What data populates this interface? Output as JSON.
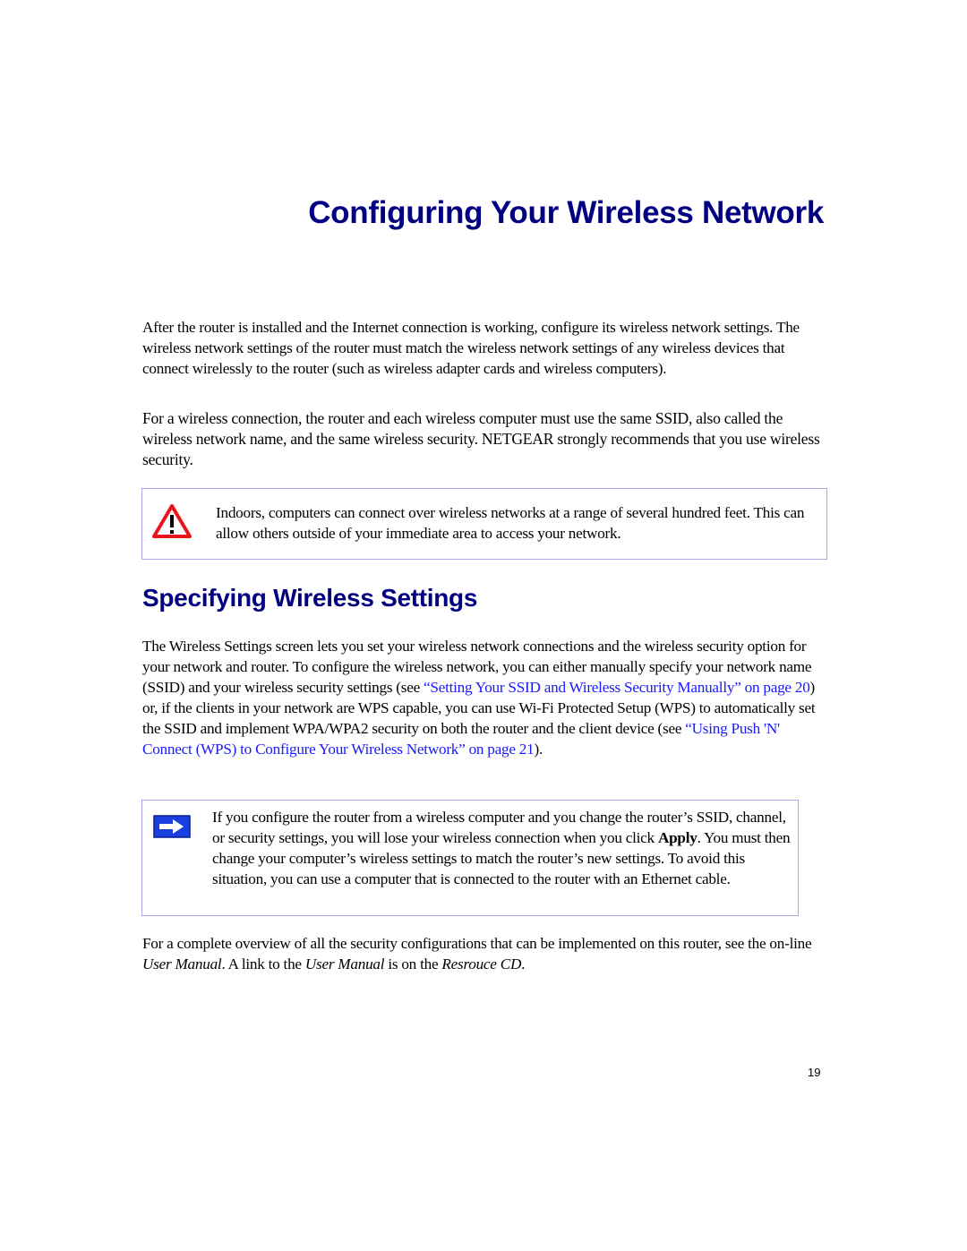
{
  "page": {
    "title": "Configuring Your Wireless Network",
    "intro_paragraphs": [
      "After the router is installed and the Internet connection is working, configure its wireless network settings. The wireless network settings of the router must match the wireless network settings of any wireless devices that connect wirelessly to the router (such as wireless adapter cards and wireless computers).",
      "For a wireless connection, the router and each wireless computer must use the same SSID, also called the wireless network name, and the same wireless security. NETGEAR strongly recommends that you use wireless security."
    ],
    "warning": {
      "icon": "warning-triangle-icon",
      "text": "Indoors, computers can connect over wireless networks at a range of several hundred feet. This can allow others outside of your immediate area to access your network."
    },
    "section": {
      "heading": "Specifying Wireless Settings",
      "para_part1": "The Wireless Settings screen lets you set your wireless network connections and the wireless security option for your network and router. To configure the wireless network, you can either manually specify your network name (SSID) and your wireless security settings (see ",
      "link1": "“Setting Your SSID and Wireless Security Manually” on page 20",
      "para_part2": ") or, if the clients in your network are WPS capable, you can use Wi-Fi Protected Setup (WPS) to automatically set the SSID and implement WPA/WPA2 security on both the router and the client device (see ",
      "link2": "“Using Push 'N' Connect (WPS) to Configure Your Wireless Network” on page 21",
      "para_part3": ")."
    },
    "note": {
      "icon": "arrow-right-icon",
      "text_part1": "If you configure the router from a wireless computer and you change the router’s SSID, channel, or security settings, you will lose your wireless connection when you click ",
      "bold": "Apply",
      "text_part2": ". You must then change your computer’s wireless settings to match the router’s new settings. To avoid this situation, you can use a computer that is connected to the router with an Ethernet cable."
    },
    "closing": {
      "part1": "For a complete overview of all the security configurations that can be implemented on this router, see the on-line ",
      "italic1": "User Manual",
      "part2": ". A link to the ",
      "italic2": "User Manual",
      "part3": " is on the ",
      "italic3": "Resrouce CD",
      "part4": "."
    },
    "page_number": "19"
  },
  "colors": {
    "heading": "#000080",
    "link": "#1a1aff",
    "box_border": "#a8a8e8",
    "warning_red": "#e8141c",
    "note_blue": "#1a3fe0"
  }
}
